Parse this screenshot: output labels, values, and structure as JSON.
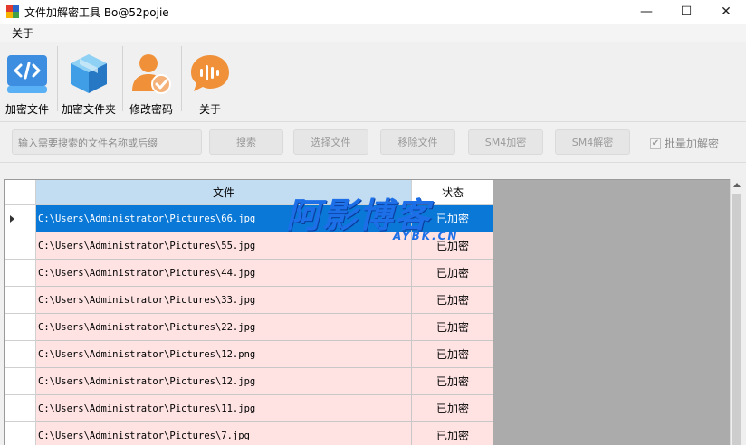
{
  "window": {
    "title": "文件加解密工具 Bo@52pojie",
    "min_glyph": "—",
    "max_glyph": "☐",
    "close_glyph": "✕"
  },
  "menu": {
    "about": "关于"
  },
  "toolbar": {
    "encrypt_file": "加密文件",
    "encrypt_folder": "加密文件夹",
    "change_password": "修改密码",
    "about": "关于"
  },
  "actions": {
    "search_placeholder": "输入需要搜索的文件名称或后缀",
    "search": "搜索",
    "select_file": "选择文件",
    "remove_file": "移除文件",
    "sm4_encrypt": "SM4加密",
    "sm4_decrypt": "SM4解密",
    "batch_label": "批量加解密",
    "batch_checked": true
  },
  "grid": {
    "columns": [
      "文件",
      "状态"
    ],
    "selected_row": 0,
    "rows": [
      {
        "file": "C:\\Users\\Administrator\\Pictures\\66.jpg",
        "status": "已加密"
      },
      {
        "file": "C:\\Users\\Administrator\\Pictures\\55.jpg",
        "status": "已加密"
      },
      {
        "file": "C:\\Users\\Administrator\\Pictures\\44.jpg",
        "status": "已加密"
      },
      {
        "file": "C:\\Users\\Administrator\\Pictures\\33.jpg",
        "status": "已加密"
      },
      {
        "file": "C:\\Users\\Administrator\\Pictures\\22.jpg",
        "status": "已加密"
      },
      {
        "file": "C:\\Users\\Administrator\\Pictures\\12.png",
        "status": "已加密"
      },
      {
        "file": "C:\\Users\\Administrator\\Pictures\\12.jpg",
        "status": "已加密"
      },
      {
        "file": "C:\\Users\\Administrator\\Pictures\\11.jpg",
        "status": "已加密"
      },
      {
        "file": "C:\\Users\\Administrator\\Pictures\\7.jpg",
        "status": "已加密"
      }
    ]
  },
  "watermark": {
    "big": "阿影博客",
    "small": "AYBK.CN"
  },
  "colors": {
    "selection": "#0a78d7",
    "row_bg": "#ffe3e3",
    "header_file_bg": "#c2dcf2",
    "watermark": "#1d6fe8"
  }
}
